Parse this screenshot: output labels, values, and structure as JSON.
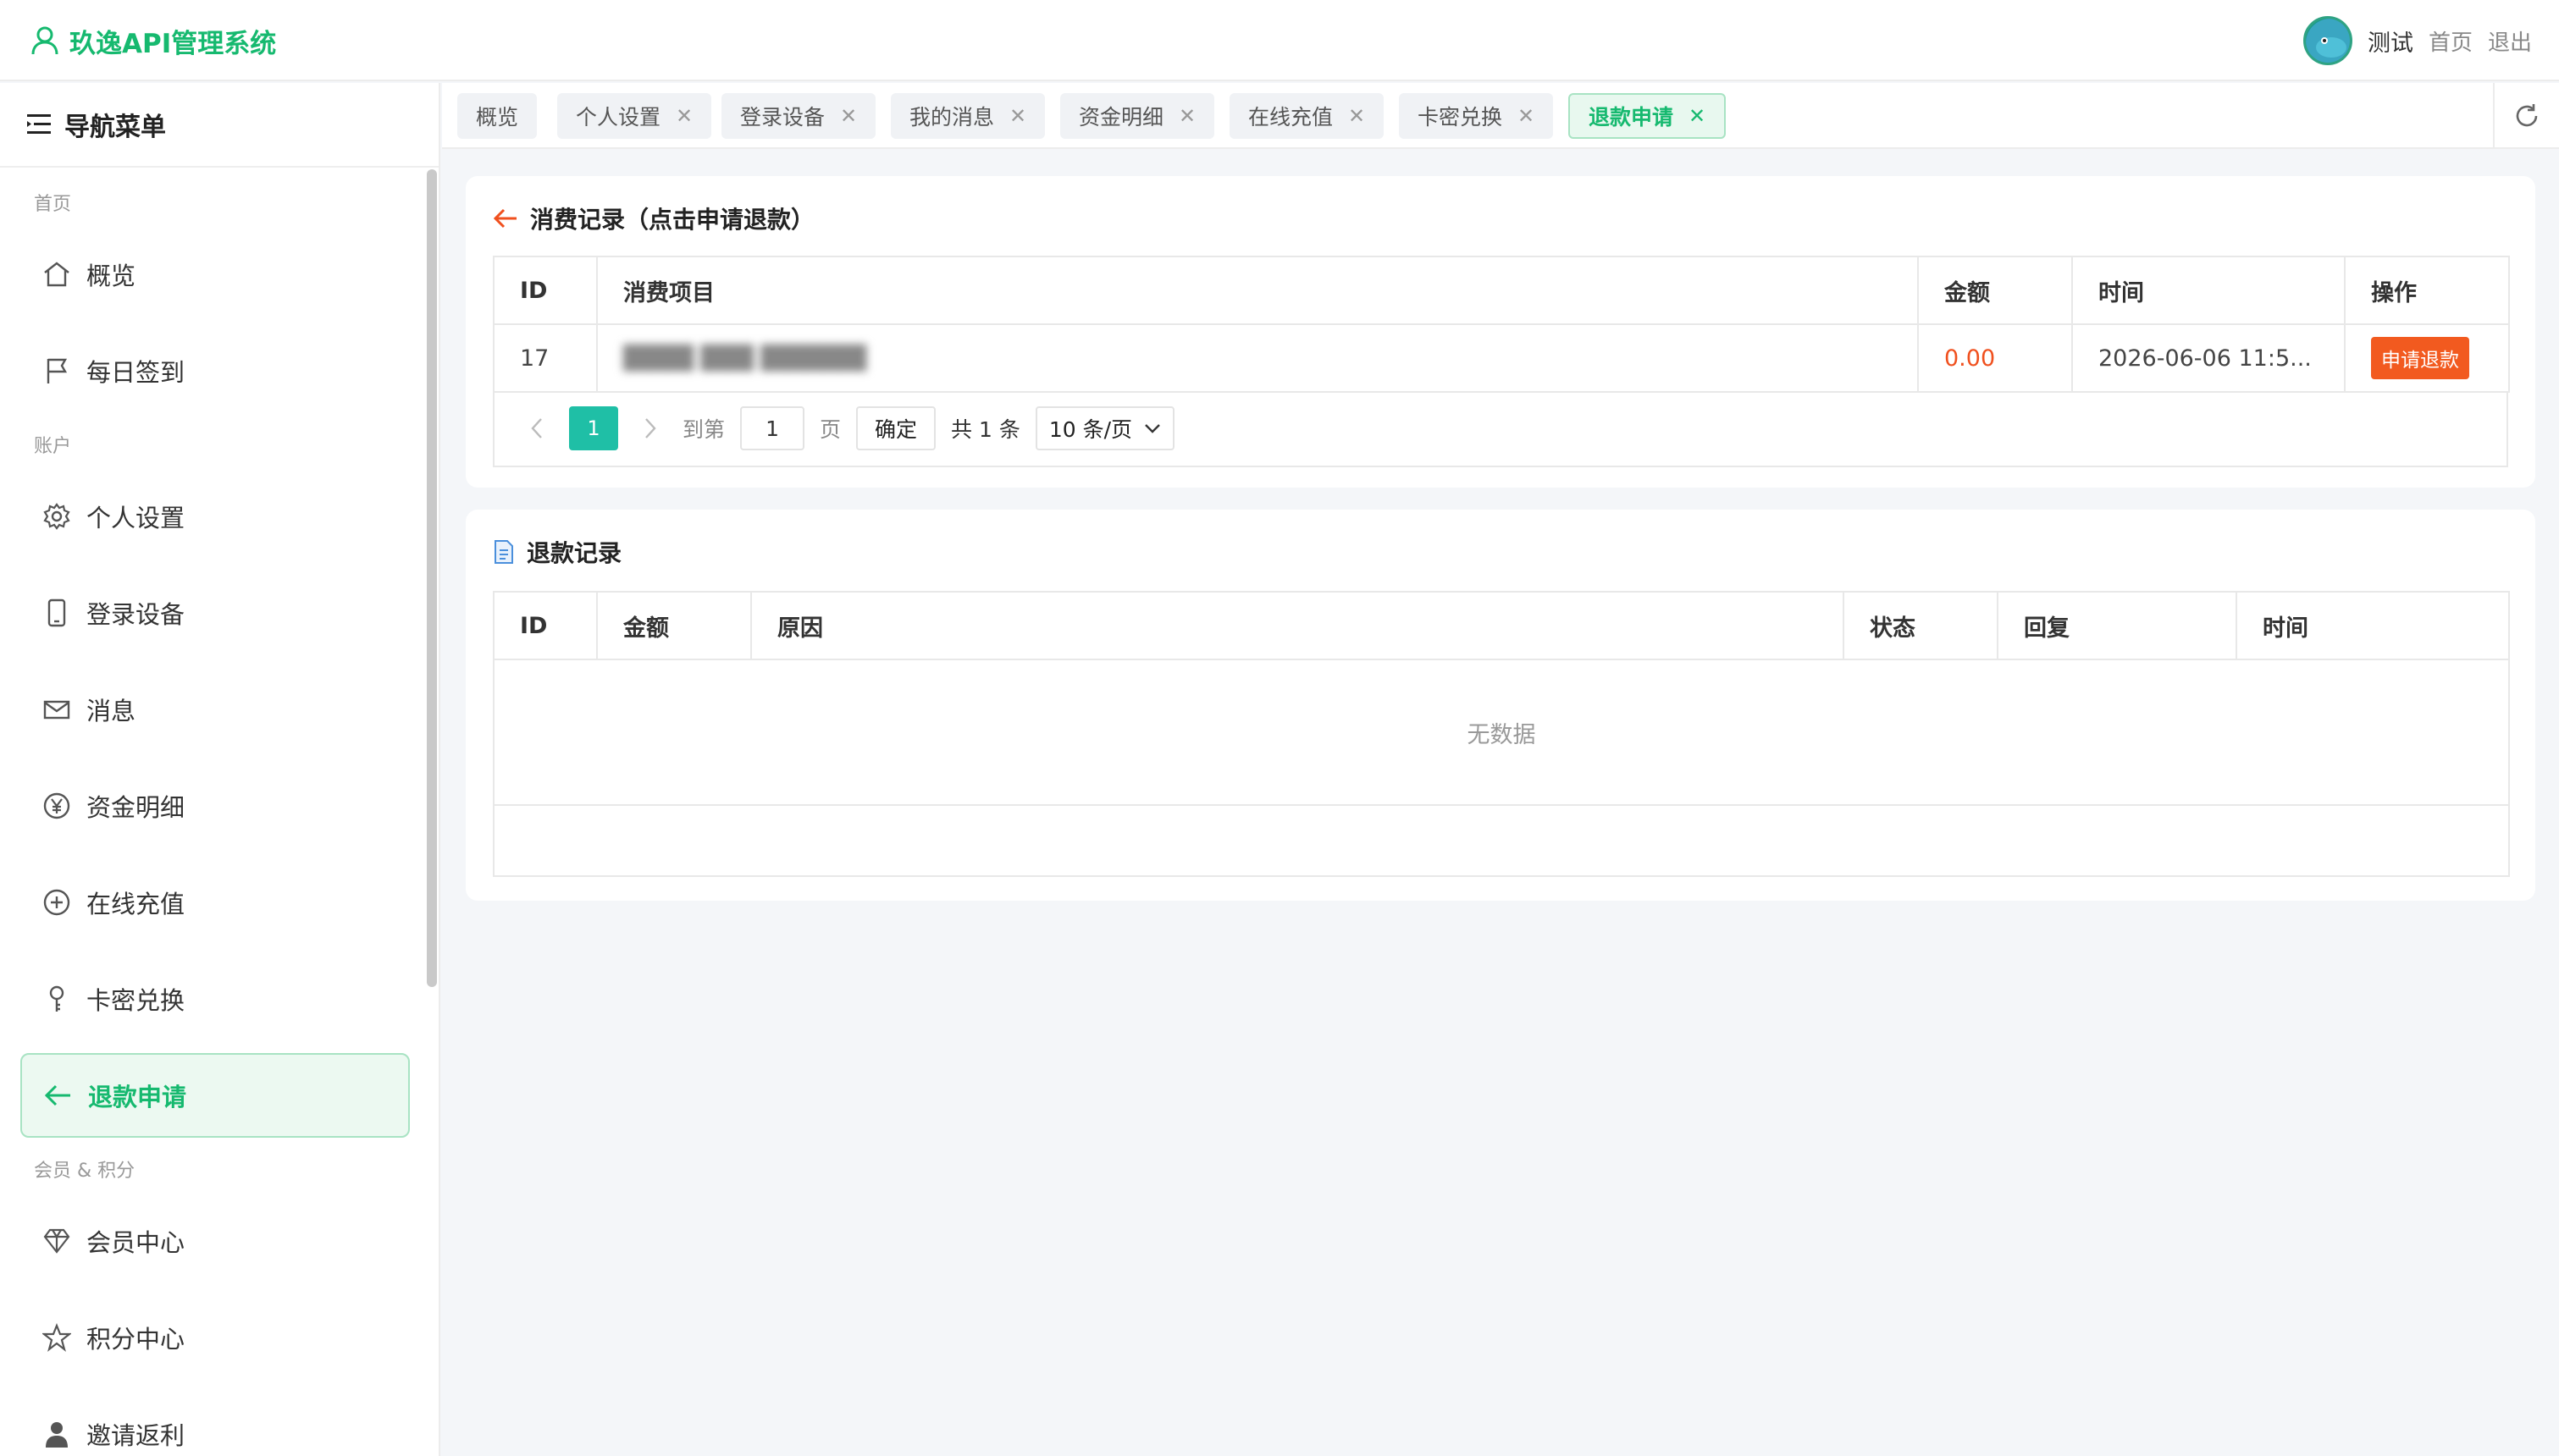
{
  "app": {
    "title": "玖逸API管理系统",
    "brand_color": "#16b96f"
  },
  "header": {
    "username": "测试",
    "home_link": "首页",
    "logout_link": "退出"
  },
  "sidebar": {
    "title": "导航菜单",
    "sections": [
      {
        "label": "首页",
        "items": [
          {
            "label": "概览",
            "icon": "home-icon"
          },
          {
            "label": "每日签到",
            "icon": "flag-icon"
          }
        ]
      },
      {
        "label": "账户",
        "items": [
          {
            "label": "个人设置",
            "icon": "gear-icon"
          },
          {
            "label": "登录设备",
            "icon": "tablet-icon"
          },
          {
            "label": "消息",
            "icon": "mail-icon"
          },
          {
            "label": "资金明细",
            "icon": "yen-icon"
          },
          {
            "label": "在线充值",
            "icon": "plus-circle-icon"
          },
          {
            "label": "卡密兑换",
            "icon": "key-icon"
          },
          {
            "label": "退款申请",
            "icon": "arrow-left-icon",
            "active": true
          }
        ]
      },
      {
        "label": "会员 & 积分",
        "items": [
          {
            "label": "会员中心",
            "icon": "diamond-icon"
          },
          {
            "label": "积分中心",
            "icon": "star-icon"
          },
          {
            "label": "邀请返利",
            "icon": "person-icon"
          }
        ]
      }
    ]
  },
  "tabs": [
    {
      "label": "概览",
      "closable": false
    },
    {
      "label": "个人设置",
      "closable": true
    },
    {
      "label": "登录设备",
      "closable": true
    },
    {
      "label": "我的消息",
      "closable": true
    },
    {
      "label": "资金明细",
      "closable": true
    },
    {
      "label": "在线充值",
      "closable": true
    },
    {
      "label": "卡密兑换",
      "closable": true
    },
    {
      "label": "退款申请",
      "closable": true,
      "active": true
    }
  ],
  "consumption": {
    "title": "消费记录（点击申请退款）",
    "columns": [
      "ID",
      "消费项目",
      "金额",
      "时间",
      "操作"
    ],
    "rows": [
      {
        "id": "17",
        "item": "████ ███ ██████",
        "amount": "0.00",
        "time": "2026-06-06 11:5...",
        "action": "申请退款"
      }
    ],
    "pagination": {
      "current": "1",
      "goto_label": "到第",
      "goto_value": "1",
      "page_unit": "页",
      "confirm": "确定",
      "total": "共 1 条",
      "page_size": "10 条/页"
    }
  },
  "refunds": {
    "title": "退款记录",
    "columns": [
      "ID",
      "金额",
      "原因",
      "状态",
      "回复",
      "时间"
    ],
    "empty_text": "无数据"
  },
  "colors": {
    "accent": "#16b96f",
    "danger": "#f25a1f",
    "pager_active": "#1fbfa6"
  }
}
